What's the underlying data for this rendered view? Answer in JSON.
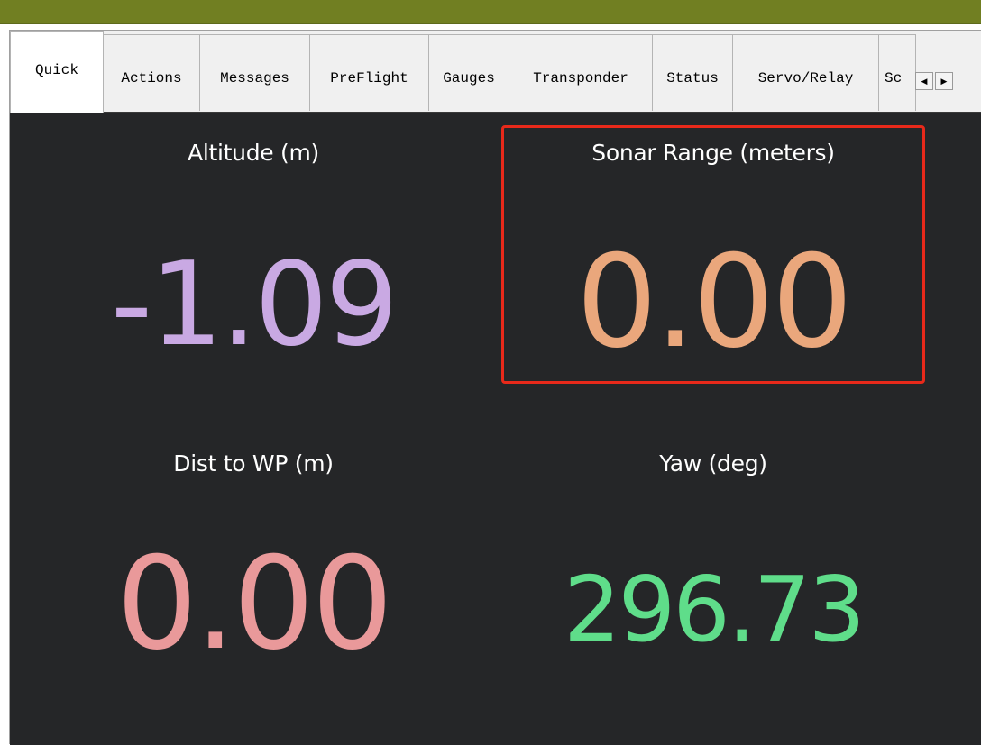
{
  "tabs": [
    {
      "label": "Quick",
      "active": true
    },
    {
      "label": "Actions",
      "active": false
    },
    {
      "label": "Messages",
      "active": false
    },
    {
      "label": "PreFlight",
      "active": false
    },
    {
      "label": "Gauges",
      "active": false
    },
    {
      "label": "Transponder",
      "active": false
    },
    {
      "label": "Status",
      "active": false
    },
    {
      "label": "Servo/Relay",
      "active": false
    },
    {
      "label": "Sc",
      "active": false
    }
  ],
  "tab_scroll": {
    "left": "◀",
    "right": "▶"
  },
  "quick": {
    "altitude": {
      "label": "Altitude (m)",
      "value": "-1.09",
      "color": "#c9a9e3"
    },
    "sonar": {
      "label": "Sonar Range (meters)",
      "value": "0.00",
      "color": "#eaa77c",
      "highlighted": true
    },
    "dist_wp": {
      "label": "Dist to WP (m)",
      "value": "0.00",
      "color": "#e9999a"
    },
    "yaw": {
      "label": "Yaw (deg)",
      "value": "296.73",
      "color": "#5fdd8a"
    }
  },
  "colors": {
    "topbar": "#717f22",
    "panel_bg": "#252628",
    "highlight": "#e8291a"
  }
}
